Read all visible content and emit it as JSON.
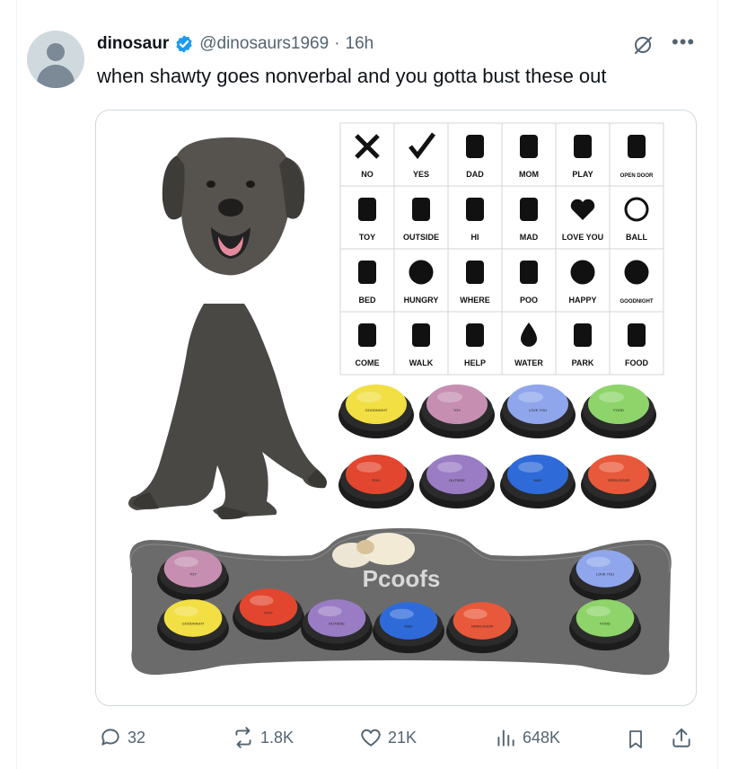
{
  "tweet": {
    "display_name": "dinosaur",
    "handle": "@dinosaurs1969",
    "separator": "·",
    "time": "16h",
    "text": "when shawty goes nonverbal and you gotta bust these out",
    "verified_color": "#1d9bf0"
  },
  "media": {
    "grid_rows": [
      [
        {
          "icon": "x-icon",
          "label": "NO"
        },
        {
          "icon": "check-icon",
          "label": "YES"
        },
        {
          "icon": "man-icon",
          "label": "DAD"
        },
        {
          "icon": "woman-icon",
          "label": "MOM"
        },
        {
          "icon": "play-icon",
          "label": "PLAY"
        },
        {
          "icon": "door-icon",
          "label": "OPEN DOOR"
        }
      ],
      [
        {
          "icon": "teddy-bear-icon",
          "label": "TOY"
        },
        {
          "icon": "tree-sun-icon",
          "label": "OUTSIDE"
        },
        {
          "icon": "waving-hand-icon",
          "label": "HI"
        },
        {
          "icon": "angry-person-icon",
          "label": "MAD"
        },
        {
          "icon": "heart-icon",
          "label": "LOVE YOU"
        },
        {
          "icon": "soccer-ball-icon",
          "label": "BALL"
        }
      ],
      [
        {
          "icon": "bed-icon",
          "label": "BED"
        },
        {
          "icon": "hungry-face-icon",
          "label": "HUNGRY"
        },
        {
          "icon": "arrows-icon",
          "label": "WHERE"
        },
        {
          "icon": "poo-icon",
          "label": "POO"
        },
        {
          "icon": "smile-icon",
          "label": "HAPPY"
        },
        {
          "icon": "moon-icon",
          "label": "GOODNIGHT"
        }
      ],
      [
        {
          "icon": "person-dog-icon",
          "label": "COME"
        },
        {
          "icon": "walking-icon",
          "label": "WALK"
        },
        {
          "icon": "handshake-icon",
          "label": "HELP"
        },
        {
          "icon": "drop-icon",
          "label": "WATER"
        },
        {
          "icon": "bench-tree-icon",
          "label": "PARK"
        },
        {
          "icon": "drumstick-icon",
          "label": "FOOD"
        }
      ]
    ],
    "buttons_top": [
      {
        "color": "#f2df43",
        "label": "GOODNIGHT"
      },
      {
        "color": "#c68fb1",
        "label": "TOY"
      },
      {
        "color": "#8fa6ec",
        "label": "LOVE YOU"
      },
      {
        "color": "#8ed46a",
        "label": "FOOD"
      }
    ],
    "buttons_bottom": [
      {
        "color": "#e2462f",
        "label": "POO"
      },
      {
        "color": "#9a7cc4",
        "label": "OUTSIDE"
      },
      {
        "color": "#2f6ad9",
        "label": "MAD"
      },
      {
        "color": "#e8583a",
        "label": "OPEN DOOR"
      }
    ],
    "board_buttons": [
      {
        "color": "#c68fb1",
        "label": "TOY"
      },
      {
        "color": "#f2df43",
        "label": "GOODNIGHT"
      },
      {
        "color": "#e2462f",
        "label": "POO"
      },
      {
        "color": "#9a7cc4",
        "label": "OUTSIDE"
      },
      {
        "color": "#2f6ad9",
        "label": "MAD"
      },
      {
        "color": "#e8583a",
        "label": "OPEN DOOR"
      },
      {
        "color": "#8fa6ec",
        "label": "LOVE YOU"
      },
      {
        "color": "#8ed46a",
        "label": "FOOD"
      }
    ],
    "board_brand": "Pcoofs"
  },
  "actions": {
    "replies": "32",
    "reposts": "1.8K",
    "likes": "21K",
    "views": "648K"
  },
  "colors": {
    "text": "#0f1419",
    "muted": "#536471",
    "border": "#cfd9de"
  }
}
